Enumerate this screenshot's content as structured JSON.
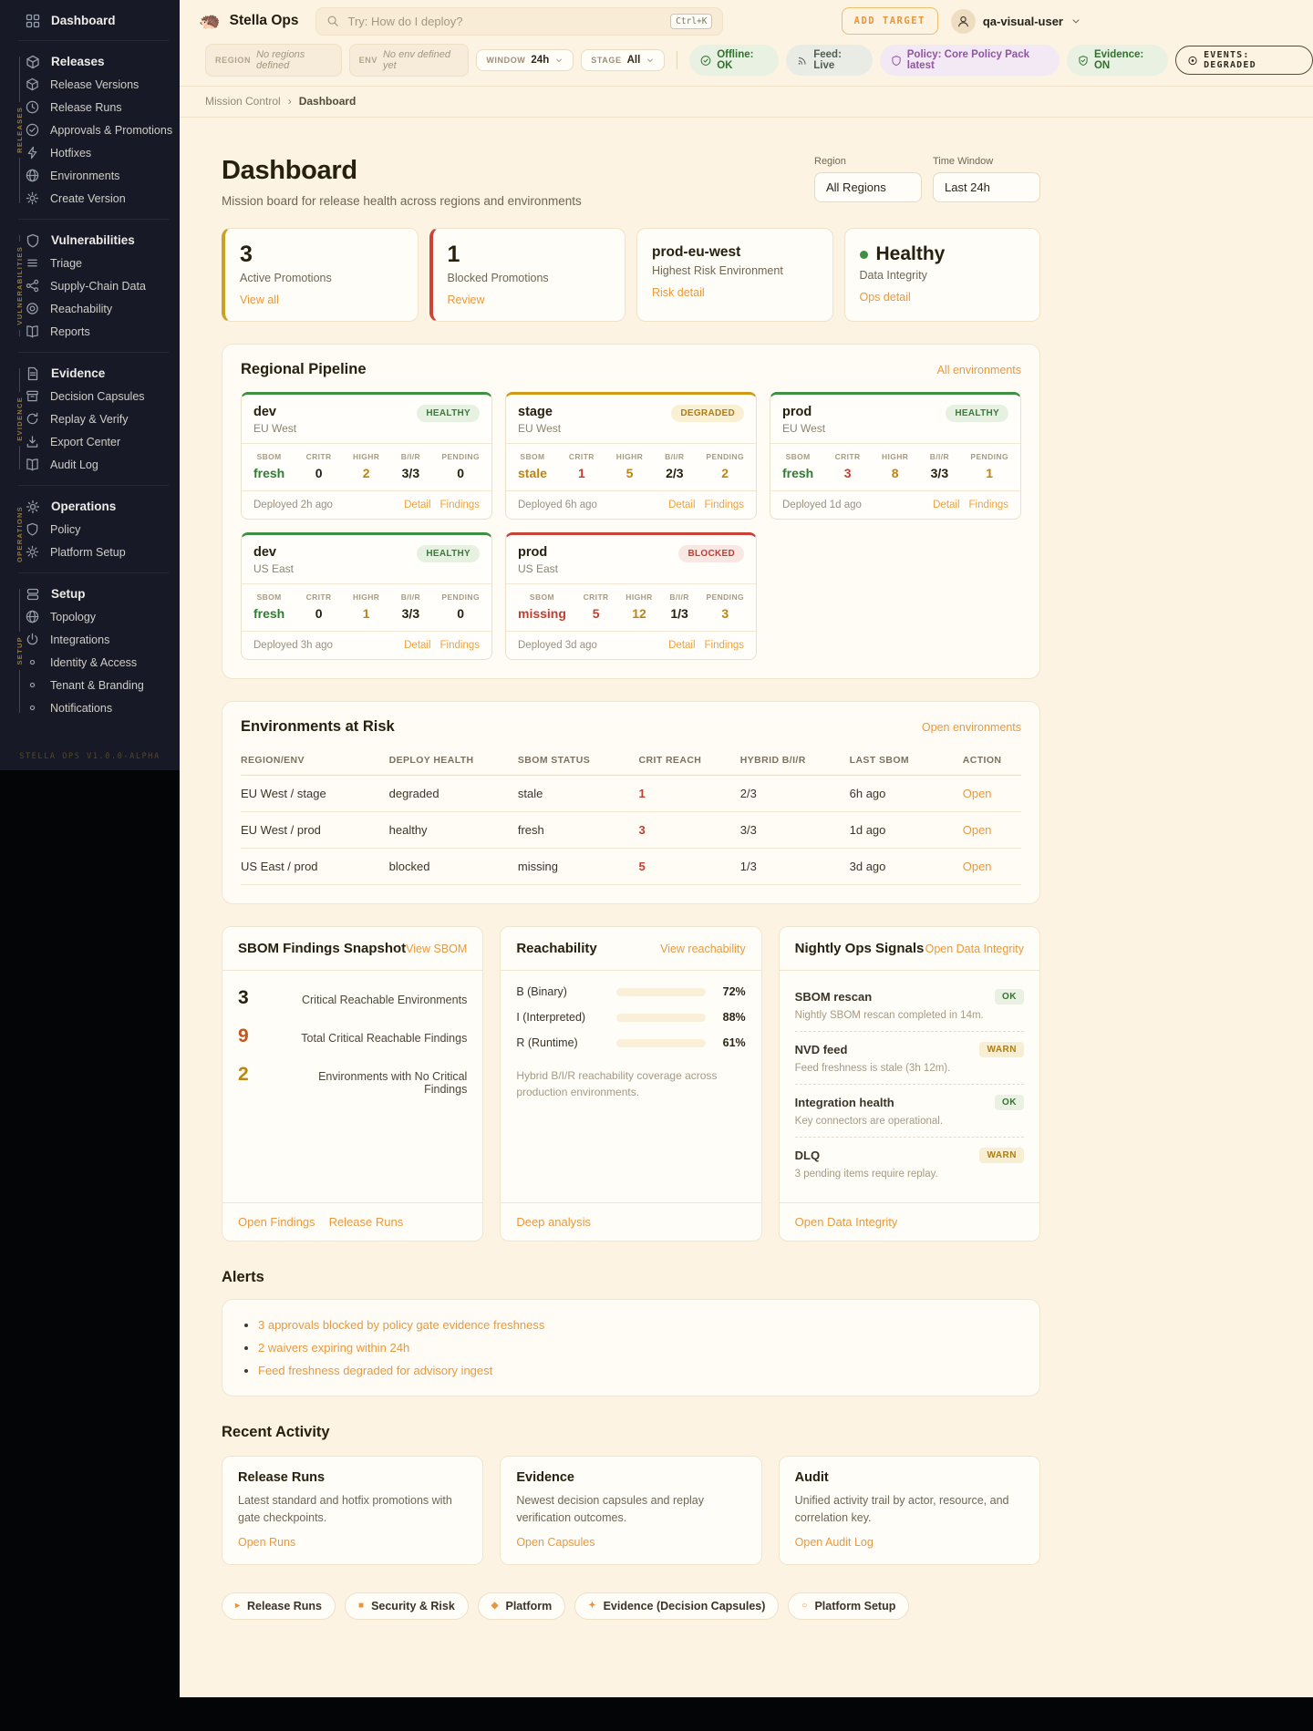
{
  "app": {
    "logo": "🦔",
    "title": "Stella Ops"
  },
  "header": {
    "search_placeholder": "Try: How do I deploy?",
    "search_kbd": "Ctrl+K",
    "add_target": "ADD TARGET",
    "user": "qa-visual-user"
  },
  "status": {
    "region_label": "REGION",
    "region_value": "No regions defined",
    "env_label": "ENV",
    "env_value": "No env defined yet",
    "window_label": "WINDOW",
    "window_value": "24h",
    "stage_label": "STAGE",
    "stage_value": "All",
    "offline": "Offline: OK",
    "feed": "Feed: Live",
    "policy": "Policy: Core Policy Pack latest",
    "evidence": "Evidence: ON",
    "events": "EVENTS: DEGRADED"
  },
  "breadcrumb": {
    "parent": "Mission Control",
    "sep": "›",
    "current": "Dashboard"
  },
  "page": {
    "title": "Dashboard",
    "subtitle": "Mission board for release health across regions and environments"
  },
  "filters": {
    "region_label": "Region",
    "region_value": "All Regions",
    "window_label": "Time Window",
    "window_value": "Last 24h"
  },
  "summary": {
    "active": {
      "value": "3",
      "label": "Active Promotions",
      "link": "View all"
    },
    "blocked": {
      "value": "1",
      "label": "Blocked Promotions",
      "link": "Review"
    },
    "risk_env": {
      "title": "prod-eu-west",
      "label": "Highest Risk Environment",
      "link": "Risk detail"
    },
    "integrity": {
      "title": "Healthy",
      "label": "Data Integrity",
      "link": "Ops detail"
    }
  },
  "pipeline": {
    "title": "Regional Pipeline",
    "link": "All environments",
    "stat_labels": [
      "SBOM",
      "CRITR",
      "HIGHR",
      "B/I/R",
      "PENDING"
    ],
    "links": [
      "Detail",
      "Findings"
    ],
    "cards": [
      {
        "env": "dev",
        "region": "EU West",
        "status": "HEALTHY",
        "sbom": "fresh",
        "critr": "0",
        "highr": "2",
        "bir": "3/3",
        "pending": "0",
        "deployed": "Deployed 2h ago"
      },
      {
        "env": "stage",
        "region": "EU West",
        "status": "DEGRADED",
        "sbom": "stale",
        "critr": "1",
        "highr": "5",
        "bir": "2/3",
        "pending": "2",
        "deployed": "Deployed 6h ago"
      },
      {
        "env": "prod",
        "region": "EU West",
        "status": "HEALTHY",
        "sbom": "fresh",
        "critr": "3",
        "highr": "8",
        "bir": "3/3",
        "pending": "1",
        "deployed": "Deployed 1d ago"
      },
      {
        "env": "dev",
        "region": "US East",
        "status": "HEALTHY",
        "sbom": "fresh",
        "critr": "0",
        "highr": "1",
        "bir": "3/3",
        "pending": "0",
        "deployed": "Deployed 3h ago"
      },
      {
        "env": "prod",
        "region": "US East",
        "status": "BLOCKED",
        "sbom": "missing",
        "critr": "5",
        "highr": "12",
        "bir": "1/3",
        "pending": "3",
        "deployed": "Deployed 3d ago"
      }
    ]
  },
  "risk_table": {
    "title": "Environments at Risk",
    "link": "Open environments",
    "columns": [
      "REGION/ENV",
      "DEPLOY HEALTH",
      "SBOM STATUS",
      "CRIT REACH",
      "HYBRID B/I/R",
      "LAST SBOM",
      "ACTION"
    ],
    "rows": [
      {
        "env": "EU West / stage",
        "health": "degraded",
        "sbom": "stale",
        "crit": "1",
        "hybrid": "2/3",
        "last": "6h ago",
        "action": "Open"
      },
      {
        "env": "EU West / prod",
        "health": "healthy",
        "sbom": "fresh",
        "crit": "3",
        "hybrid": "3/3",
        "last": "1d ago",
        "action": "Open"
      },
      {
        "env": "US East / prod",
        "health": "blocked",
        "sbom": "missing",
        "crit": "5",
        "hybrid": "1/3",
        "last": "3d ago",
        "action": "Open"
      }
    ]
  },
  "sbom_card": {
    "title": "SBOM Findings Snapshot",
    "link": "View SBOM",
    "stats": [
      {
        "value": "3",
        "label": "Critical Reachable Environments"
      },
      {
        "value": "9",
        "label": "Total Critical Reachable Findings"
      },
      {
        "value": "2",
        "label": "Environments with No Critical Findings"
      }
    ],
    "footer_links": [
      "Open Findings",
      "Release Runs"
    ]
  },
  "reach_card": {
    "title": "Reachability",
    "link": "View reachability",
    "bars": [
      {
        "label": "B (Binary)",
        "pct": 72,
        "pct_label": "72%"
      },
      {
        "label": "I (Interpreted)",
        "pct": 88,
        "pct_label": "88%"
      },
      {
        "label": "R (Runtime)",
        "pct": 61,
        "pct_label": "61%"
      }
    ],
    "description": "Hybrid B/I/R reachability coverage across production environments.",
    "footer_link": "Deep analysis"
  },
  "ops_card": {
    "title": "Nightly Ops Signals",
    "link": "Open Data Integrity",
    "signals": [
      {
        "name": "SBOM rescan",
        "badge": "OK",
        "desc": "Nightly SBOM rescan completed in 14m."
      },
      {
        "name": "NVD feed",
        "badge": "WARN",
        "desc": "Feed freshness is stale (3h 12m)."
      },
      {
        "name": "Integration health",
        "badge": "OK",
        "desc": "Key connectors are operational."
      },
      {
        "name": "DLQ",
        "badge": "WARN",
        "desc": "3 pending items require replay."
      }
    ],
    "footer_link": "Open Data Integrity"
  },
  "alerts": {
    "title": "Alerts",
    "items": [
      "3 approvals blocked by policy gate evidence freshness",
      "2 waivers expiring within 24h",
      "Feed freshness degraded for advisory ingest"
    ]
  },
  "activity": {
    "title": "Recent Activity",
    "cards": [
      {
        "title": "Release Runs",
        "desc": "Latest standard and hotfix promotions with gate checkpoints.",
        "link": "Open Runs"
      },
      {
        "title": "Evidence",
        "desc": "Newest decision capsules and replay verification outcomes.",
        "link": "Open Capsules"
      },
      {
        "title": "Audit",
        "desc": "Unified activity trail by actor, resource, and correlation key.",
        "link": "Open Audit Log"
      }
    ]
  },
  "footer_chips": [
    {
      "icon": "▸",
      "label": "Release Runs"
    },
    {
      "icon": "■",
      "label": "Security & Risk"
    },
    {
      "icon": "◆",
      "label": "Platform"
    },
    {
      "icon": "✦",
      "label": "Evidence (Decision Capsules)"
    },
    {
      "icon": "○",
      "label": "Platform Setup"
    }
  ],
  "sidebar": {
    "dashboard": "Dashboard",
    "version": "STELLA OPS V1.0.0-ALPHA",
    "groups": [
      {
        "rail": "RELEASES",
        "items": [
          "Releases",
          "Release Versions",
          "Release Runs",
          "Approvals & Promotions",
          "Hotfixes",
          "Environments",
          "Create Version"
        ]
      },
      {
        "rail": "VULNERABILITIES",
        "items": [
          "Vulnerabilities",
          "Triage",
          "Supply-Chain Data",
          "Reachability",
          "Reports"
        ]
      },
      {
        "rail": "EVIDENCE",
        "items": [
          "Evidence",
          "Decision Capsules",
          "Replay & Verify",
          "Export Center",
          "Audit Log"
        ]
      },
      {
        "rail": "OPERATIONS",
        "items": [
          "Operations",
          "Policy",
          "Platform Setup"
        ]
      },
      {
        "rail": "SETUP",
        "items": [
          "Setup",
          "Topology",
          "Integrations",
          "Identity & Access",
          "Tenant & Branding",
          "Notifications"
        ]
      }
    ]
  },
  "colors": {
    "accent_orange": "#e8953c",
    "green": "#2e7d32",
    "gold": "#bf8312",
    "red": "#c43e30"
  }
}
